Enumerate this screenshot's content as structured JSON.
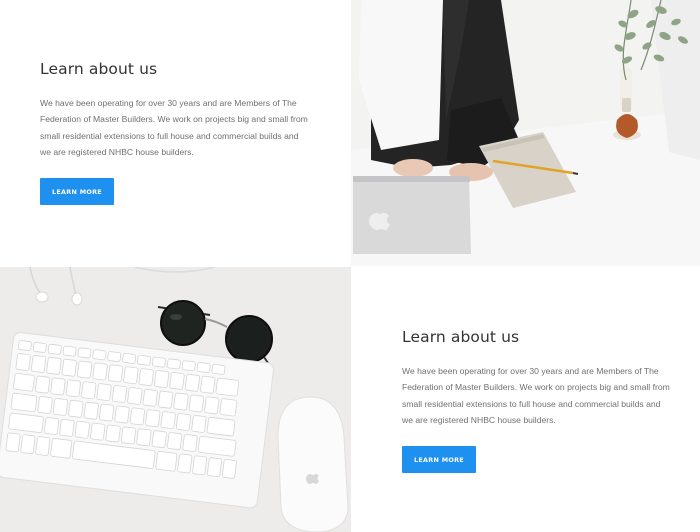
{
  "sections": [
    {
      "title": "Learn about us",
      "body": "We have been operating for over 30 years and are Members of The Federation of Master Builders. We work on projects big and small from small residential extensions to full house and commercial builds and we are registered NHBC house builders.",
      "button_label": "LEARN MORE"
    },
    {
      "title": "Learn about us",
      "body": "We have been operating for over 30 years and are Members of The Federation of Master Builders. We work on projects big and small from small residential extensions to full house and commercial builds and we are registered NHBC house builders.",
      "button_label": "LEARN MORE"
    }
  ],
  "colors": {
    "accent": "#1e90ef",
    "heading": "#333333",
    "body_text": "#707070"
  },
  "photos": [
    {
      "subject": "person-working-on-laptop-photo"
    },
    {
      "subject": "keyboard-mouse-sunglasses-desk-photo"
    }
  ]
}
